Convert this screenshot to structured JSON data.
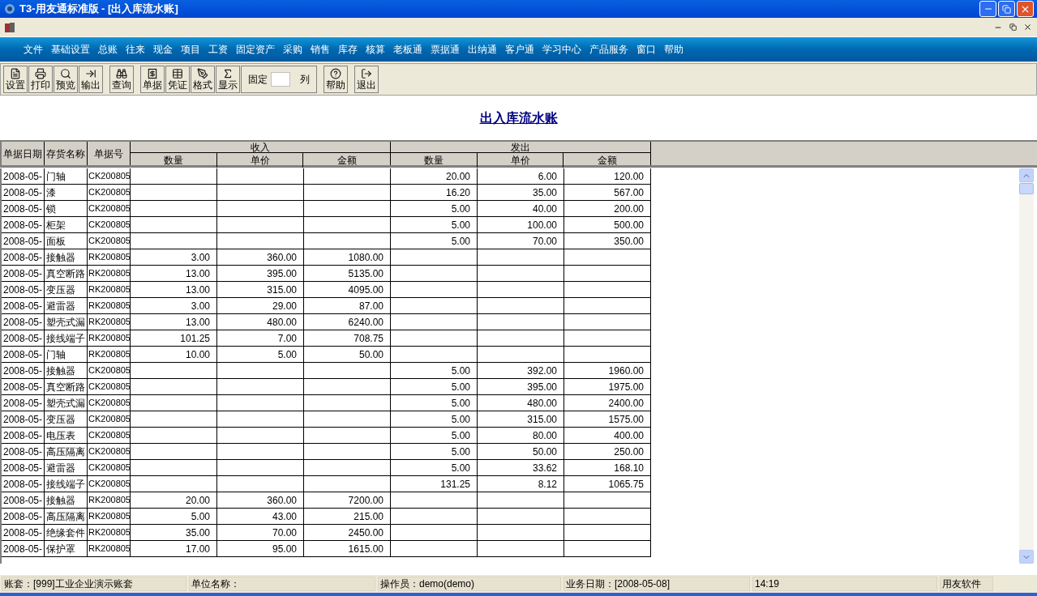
{
  "window": {
    "title": "T3-用友通标准版 - [出入库流水账]"
  },
  "menu": [
    "文件",
    "基础设置",
    "总账",
    "往来",
    "现金",
    "项目",
    "工资",
    "固定资产",
    "采购",
    "销售",
    "库存",
    "核算",
    "老板通",
    "票据通",
    "出纳通",
    "客户通",
    "学习中心",
    "产品服务",
    "窗口",
    "帮助"
  ],
  "toolbar": [
    {
      "kind": "button",
      "label": "设置"
    },
    {
      "kind": "button",
      "label": "打印"
    },
    {
      "kind": "button",
      "label": "预览"
    },
    {
      "kind": "button",
      "label": "输出"
    },
    {
      "kind": "gap"
    },
    {
      "kind": "button",
      "label": "查询"
    },
    {
      "kind": "gap"
    },
    {
      "kind": "button",
      "label": "单据"
    },
    {
      "kind": "button",
      "label": "凭证"
    },
    {
      "kind": "button",
      "label": "格式"
    },
    {
      "kind": "button",
      "label": "显示"
    },
    {
      "kind": "fixed",
      "label": "固定",
      "suffix": "列"
    },
    {
      "kind": "gap"
    },
    {
      "kind": "button",
      "label": "帮助"
    },
    {
      "kind": "gap"
    },
    {
      "kind": "button",
      "label": "退出"
    }
  ],
  "report": {
    "title": "出入库流水账",
    "columns": [
      "单据日期",
      "存货名称",
      "单据号"
    ],
    "groups": [
      {
        "label": "收入",
        "columns": [
          "数量",
          "单价",
          "金额"
        ]
      },
      {
        "label": "发出",
        "columns": [
          "数量",
          "单价",
          "金额"
        ]
      }
    ],
    "rows": [
      {
        "date": "2008-05-",
        "name": "门轴",
        "doc_no": "CK200805",
        "out": [
          "20.00",
          "6.00",
          "120.00"
        ]
      },
      {
        "date": "2008-05-",
        "name": "漆",
        "doc_no": "CK200805",
        "out": [
          "16.20",
          "35.00",
          "567.00"
        ]
      },
      {
        "date": "2008-05-",
        "name": "锁",
        "doc_no": "CK200805",
        "out": [
          "5.00",
          "40.00",
          "200.00"
        ]
      },
      {
        "date": "2008-05-",
        "name": "柜架",
        "doc_no": "CK200805",
        "out": [
          "5.00",
          "100.00",
          "500.00"
        ]
      },
      {
        "date": "2008-05-",
        "name": "面板",
        "doc_no": "CK200805",
        "out": [
          "5.00",
          "70.00",
          "350.00"
        ]
      },
      {
        "date": "2008-05-",
        "name": "接触器",
        "doc_no": "RK200805",
        "in": [
          "3.00",
          "360.00",
          "1080.00"
        ]
      },
      {
        "date": "2008-05-",
        "name": "真空断路",
        "doc_no": "RK200805",
        "in": [
          "13.00",
          "395.00",
          "5135.00"
        ]
      },
      {
        "date": "2008-05-",
        "name": "变压器",
        "doc_no": "RK200805",
        "in": [
          "13.00",
          "315.00",
          "4095.00"
        ]
      },
      {
        "date": "2008-05-",
        "name": "避雷器",
        "doc_no": "RK200805",
        "in": [
          "3.00",
          "29.00",
          "87.00"
        ]
      },
      {
        "date": "2008-05-",
        "name": "塑壳式漏",
        "doc_no": "RK200805",
        "in": [
          "13.00",
          "480.00",
          "6240.00"
        ]
      },
      {
        "date": "2008-05-",
        "name": "接线端子",
        "doc_no": "RK200805",
        "in": [
          "101.25",
          "7.00",
          "708.75"
        ]
      },
      {
        "date": "2008-05-",
        "name": "门轴",
        "doc_no": "RK200805",
        "in": [
          "10.00",
          "5.00",
          "50.00"
        ]
      },
      {
        "date": "2008-05-",
        "name": "接触器",
        "doc_no": "CK200805",
        "out": [
          "5.00",
          "392.00",
          "1960.00"
        ]
      },
      {
        "date": "2008-05-",
        "name": "真空断路",
        "doc_no": "CK200805",
        "out": [
          "5.00",
          "395.00",
          "1975.00"
        ]
      },
      {
        "date": "2008-05-",
        "name": "塑壳式漏",
        "doc_no": "CK200805",
        "out": [
          "5.00",
          "480.00",
          "2400.00"
        ]
      },
      {
        "date": "2008-05-",
        "name": "变压器",
        "doc_no": "CK200805",
        "out": [
          "5.00",
          "315.00",
          "1575.00"
        ]
      },
      {
        "date": "2008-05-",
        "name": "电压表",
        "doc_no": "CK200805",
        "out": [
          "5.00",
          "80.00",
          "400.00"
        ]
      },
      {
        "date": "2008-05-",
        "name": "高压隔离",
        "doc_no": "CK200805",
        "out": [
          "5.00",
          "50.00",
          "250.00"
        ]
      },
      {
        "date": "2008-05-",
        "name": "避雷器",
        "doc_no": "CK200805",
        "out": [
          "5.00",
          "33.62",
          "168.10"
        ]
      },
      {
        "date": "2008-05-",
        "name": "接线端子",
        "doc_no": "CK200805",
        "out": [
          "131.25",
          "8.12",
          "1065.75"
        ]
      },
      {
        "date": "2008-05-",
        "name": "接触器",
        "doc_no": "RK200805",
        "in": [
          "20.00",
          "360.00",
          "7200.00"
        ]
      },
      {
        "date": "2008-05-",
        "name": "高压隔离",
        "doc_no": "RK200805",
        "in": [
          "5.00",
          "43.00",
          "215.00"
        ]
      },
      {
        "date": "2008-05-",
        "name": "绝缘套件",
        "doc_no": "RK200805",
        "in": [
          "35.00",
          "70.00",
          "2450.00"
        ]
      },
      {
        "date": "2008-05-",
        "name": "保护罩",
        "doc_no": "RK200805",
        "in": [
          "17.00",
          "95.00",
          "1615.00"
        ]
      }
    ]
  },
  "status_bar": [
    "账套：[999]工业企业演示账套",
    "单位名称：",
    "操作员：demo(demo)",
    "业务日期：[2008-05-08]",
    "14:19",
    "用友软件"
  ]
}
